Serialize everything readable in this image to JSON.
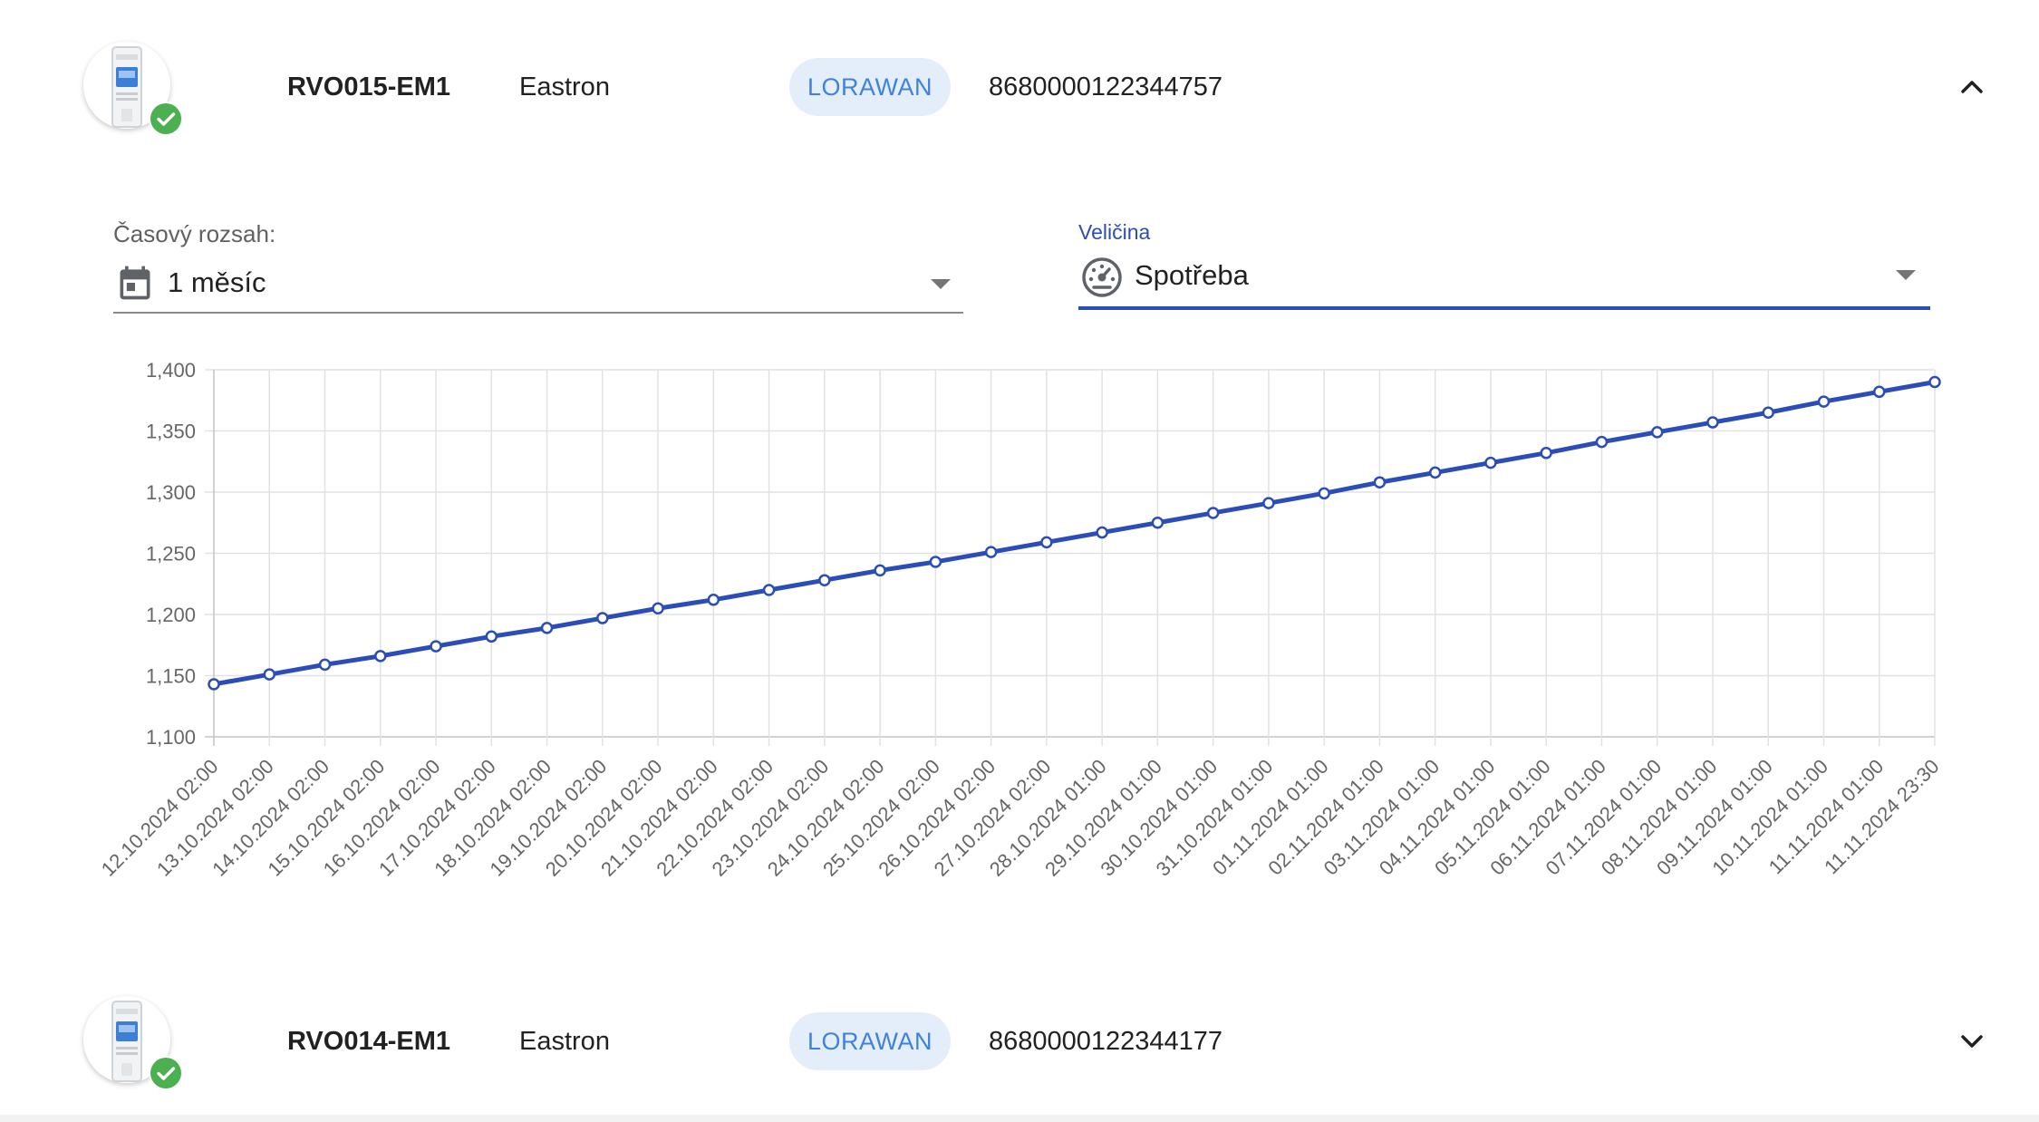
{
  "devices": [
    {
      "name": "RVO015-EM1",
      "vendor": "Eastron",
      "protocol": "LORAWAN",
      "identifier": "8680000122344757",
      "status_icon": "check-circle-icon",
      "expanded": true,
      "toggle_icon": "chevron-up-icon"
    },
    {
      "name": "RVO014-EM1",
      "vendor": "Eastron",
      "protocol": "LORAWAN",
      "identifier": "8680000122344177",
      "status_icon": "check-circle-icon",
      "expanded": false,
      "toggle_icon": "chevron-down-icon"
    }
  ],
  "filters": {
    "time_range": {
      "label": "Časový rozsah:",
      "value": "1 měsíc",
      "icon": "calendar-icon"
    },
    "quantity": {
      "label": "Veličina",
      "value": "Spotřeba",
      "icon": "gauge-icon"
    }
  },
  "colors": {
    "accent": "#2b4db8",
    "chip_background": "#e4eefb",
    "chip_text": "#3f82de",
    "status_ok": "#4caf50",
    "grid": "#e0e0e0"
  },
  "chart_data": {
    "type": "line",
    "x": [
      "12.10.2024 02:00",
      "13.10.2024 02:00",
      "14.10.2024 02:00",
      "15.10.2024 02:00",
      "16.10.2024 02:00",
      "17.10.2024 02:00",
      "18.10.2024 02:00",
      "19.10.2024 02:00",
      "20.10.2024 02:00",
      "21.10.2024 02:00",
      "22.10.2024 02:00",
      "23.10.2024 02:00",
      "24.10.2024 02:00",
      "25.10.2024 02:00",
      "26.10.2024 02:00",
      "27.10.2024 02:00",
      "28.10.2024 01:00",
      "29.10.2024 01:00",
      "30.10.2024 01:00",
      "31.10.2024 01:00",
      "01.11.2024 01:00",
      "02.11.2024 01:00",
      "03.11.2024 01:00",
      "04.11.2024 01:00",
      "05.11.2024 01:00",
      "06.11.2024 01:00",
      "07.11.2024 01:00",
      "08.11.2024 01:00",
      "09.11.2024 01:00",
      "10.11.2024 01:00",
      "11.11.2024 01:00",
      "11.11.2024 23:30"
    ],
    "series": [
      {
        "values": [
          1143,
          1151,
          1159,
          1166,
          1174,
          1182,
          1189,
          1197,
          1205,
          1212,
          1220,
          1228,
          1236,
          1243,
          1251,
          1259,
          1267,
          1275,
          1283,
          1291,
          1299,
          1308,
          1316,
          1324,
          1332,
          1341,
          1349,
          1357,
          1365,
          1374,
          1382,
          1390
        ]
      }
    ],
    "y_ticks": [
      "1,100",
      "1,150",
      "1,200",
      "1,250",
      "1,300",
      "1,350",
      "1,400"
    ],
    "ylim": [
      1100,
      1400
    ],
    "grid": true,
    "legend": "none",
    "line_color": "#2b4db8"
  }
}
